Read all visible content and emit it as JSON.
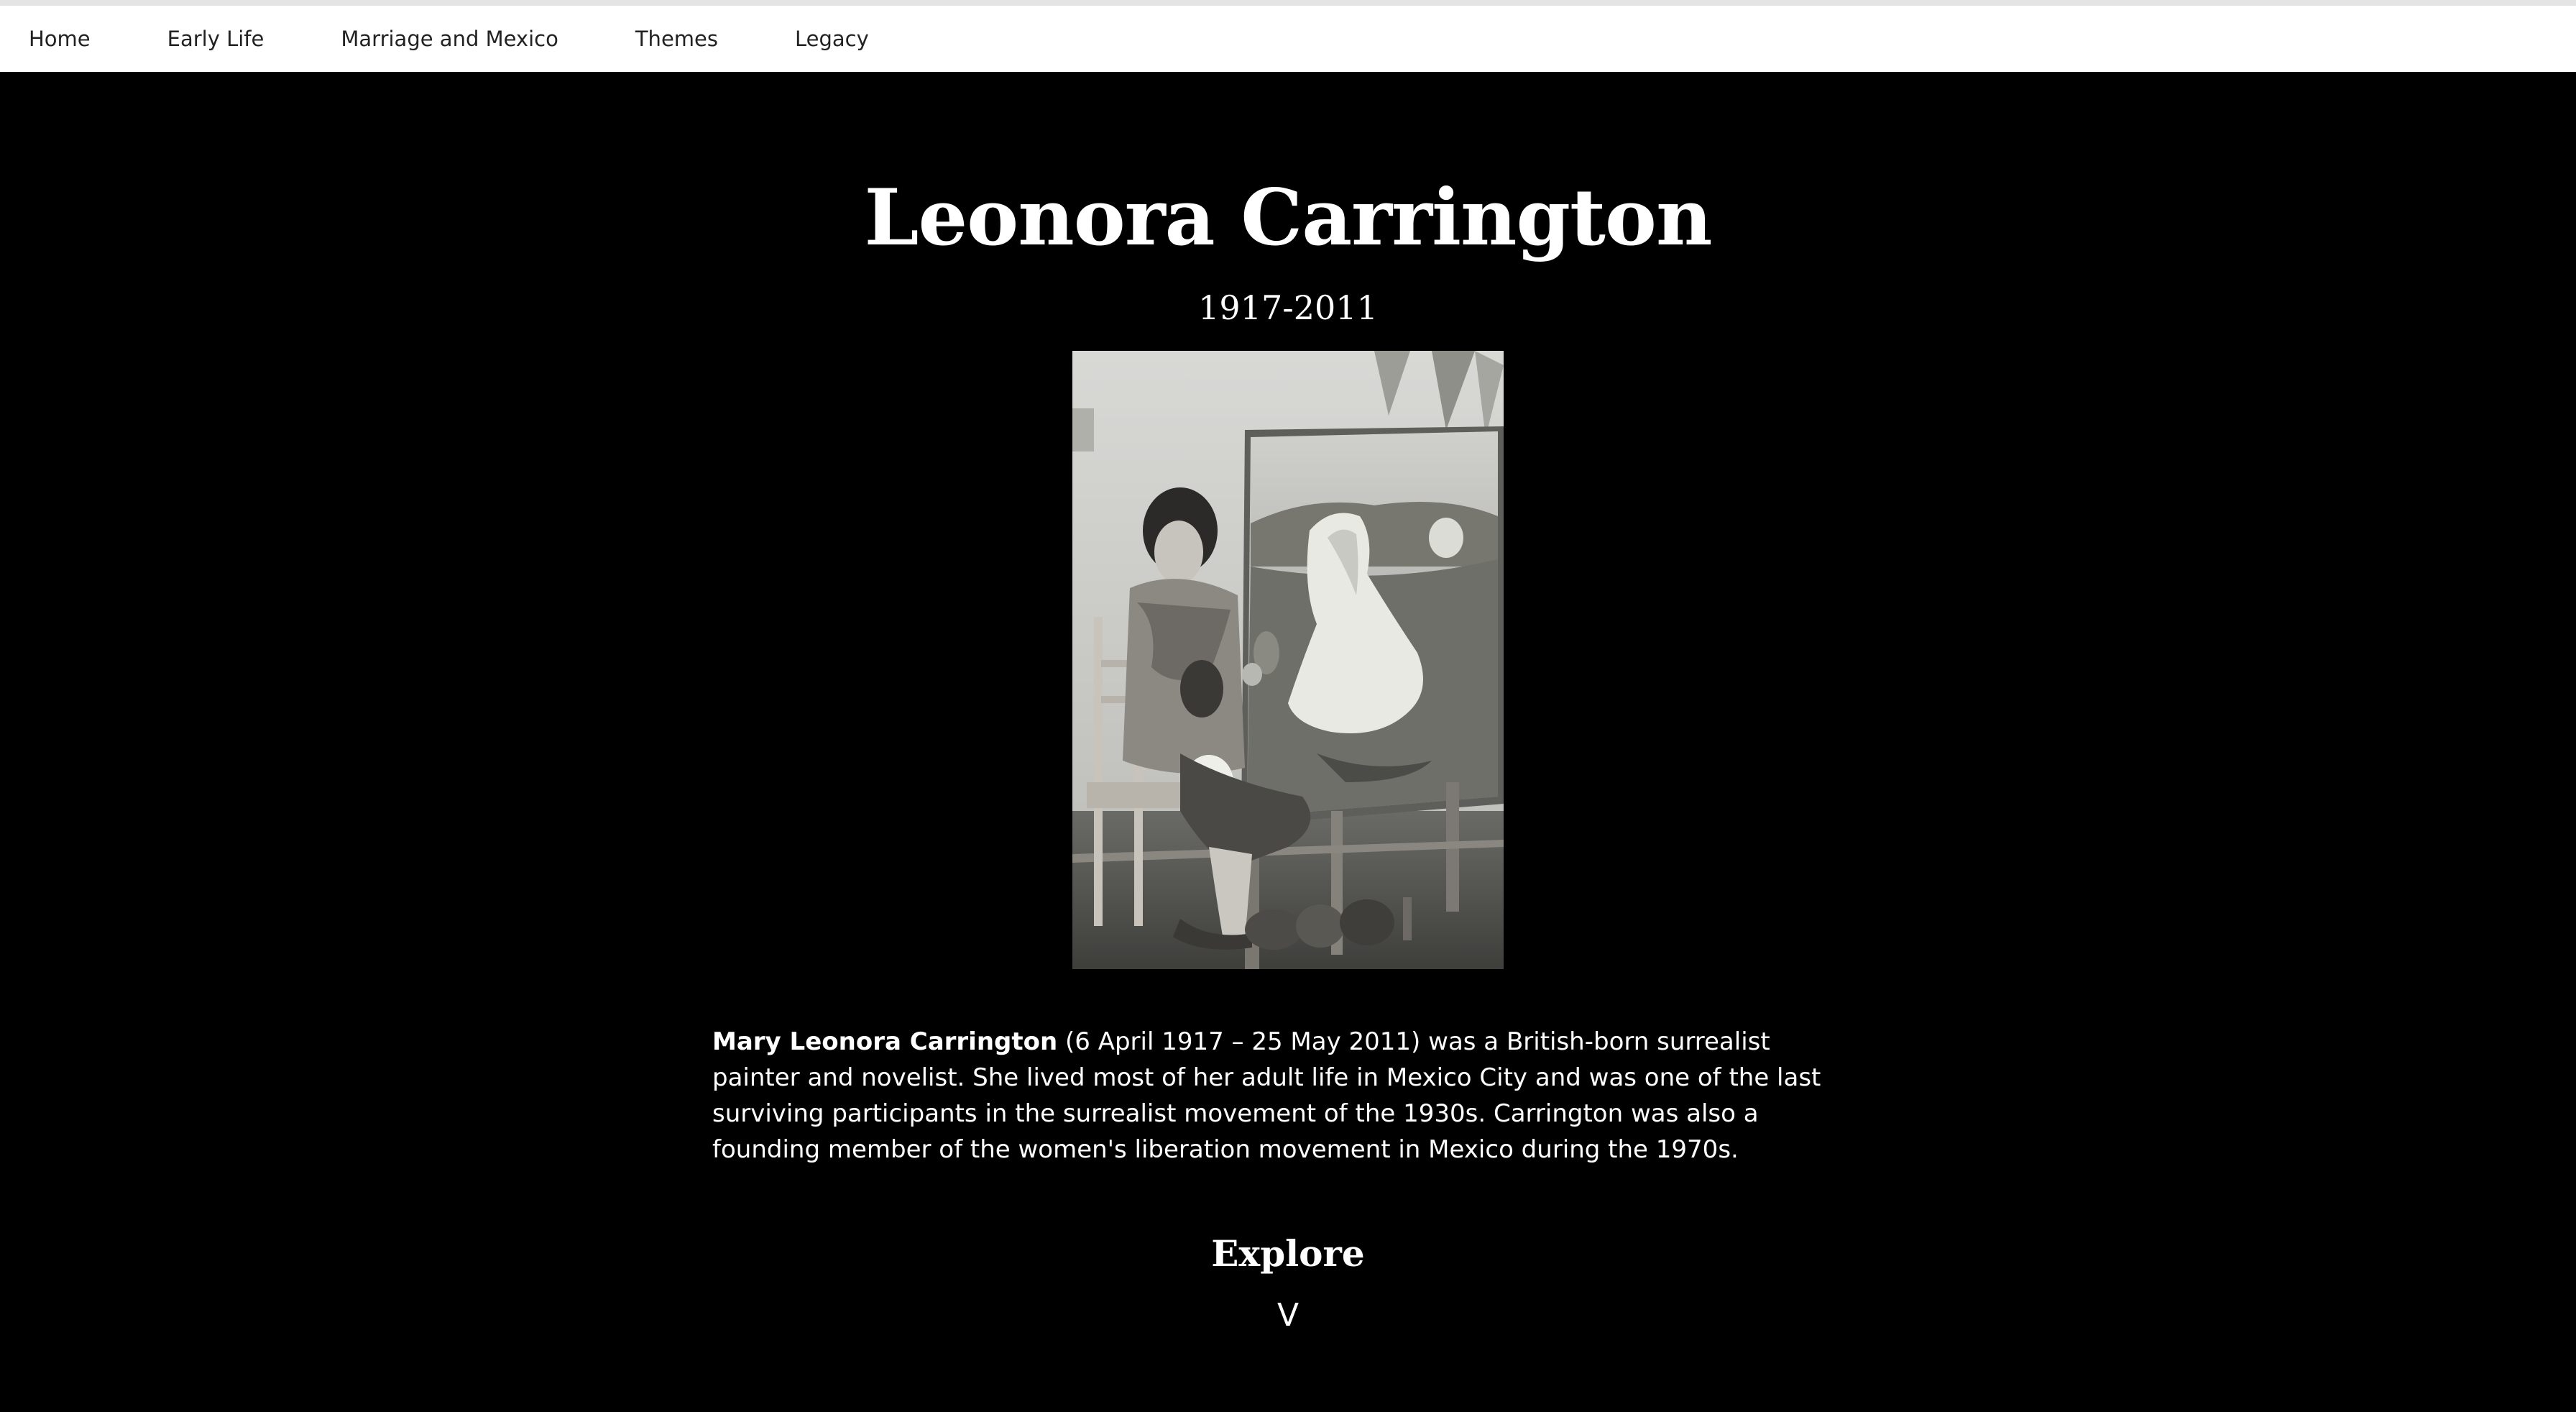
{
  "nav": {
    "items": [
      {
        "label": "Home"
      },
      {
        "label": "Early Life"
      },
      {
        "label": "Marriage and Mexico"
      },
      {
        "label": "Themes"
      },
      {
        "label": "Legacy"
      }
    ]
  },
  "hero": {
    "title": "Leonora Carrington",
    "years": "1917-2011",
    "bio_bold": "Mary Leonora Carrington",
    "bio_text": " (6 April 1917 – 25 May 2011) was a British-born surrealist painter and novelist. She lived most of her adult life in Mexico City and was one of the last surviving participants in the surrealist movement of the 1930s. Carrington was also a founding member of the women's liberation movement in Mexico during the 1970s.",
    "explore_label": "Explore",
    "explore_arrow": "V"
  },
  "colors": {
    "hero_background": "#000000",
    "nav_background": "#ffffff",
    "text_on_dark": "#ffffff",
    "nav_text": "#222222"
  },
  "icons": {
    "scroll": "chevron-down-icon"
  }
}
